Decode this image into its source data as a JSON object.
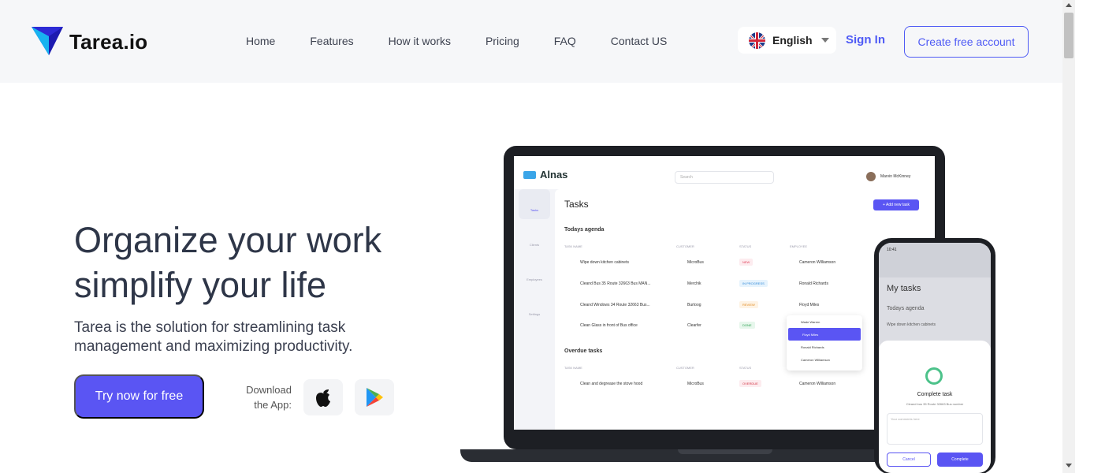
{
  "header": {
    "brand": "Tarea.io",
    "nav": [
      "Home",
      "Features",
      "How it works",
      "Pricing",
      "FAQ",
      "Contact US"
    ],
    "language": "English",
    "signin": "Sign In",
    "create": "Create free account"
  },
  "hero": {
    "title_line1": "Organize your work",
    "title_line2": "simplify your life",
    "subtitle": "Tarea is the solution for streamlining task management and maximizing productivity.",
    "cta": "Try now for free",
    "download_line1": "Download",
    "download_line2": "the App:"
  },
  "laptop_app": {
    "brand": "Alnas",
    "search_placeholder": "Search",
    "user": "Marvin McKinney",
    "title": "Tasks",
    "add_task": "+ Add new task",
    "sidebar": [
      "Tasks",
      "Clients",
      "Employees",
      "Settings"
    ],
    "agenda_title": "Todays agenda",
    "columns": [
      "TASK NAME",
      "CUSTOMER",
      "STATUS",
      "EMPLOYEE"
    ],
    "rows": [
      {
        "name": "Wipe down kitchen cabinets",
        "customer": "MicroBus",
        "status": "NEW",
        "employee": "Cameron Williamson"
      },
      {
        "name": "Cleand Bus 35 Route 32663 Bus MAN...",
        "customer": "Merchik",
        "status": "IN PROGRESS",
        "employee": "Ronald Richards"
      },
      {
        "name": "Cleand Windows 34 Route 32663 Bus...",
        "customer": "Burtoog",
        "status": "REVIEW",
        "employee": "Floyd Miles"
      },
      {
        "name": "Clean Glass in front of Bus office",
        "customer": "Clearfer",
        "status": "DONE",
        "employee": ""
      }
    ],
    "overdue_title": "Overdue tasks",
    "overdue_rows": [
      {
        "name": "Clean and degrease the stove hood",
        "customer": "MicroBus",
        "status": "OVERDUE",
        "employee": "Cameron Williamson"
      }
    ],
    "dropdown": [
      "Wade Warren",
      "Floyd Miles",
      "Ronald Richards",
      "Cameron Williamson"
    ]
  },
  "phone_app": {
    "time": "10:41",
    "title": "My tasks",
    "agenda": "Todays agenda",
    "item": "Wipe down kitchen cabinets",
    "sheet_title": "Complete task",
    "sheet_sub": "Cleand bus 35 Route 32663 Bus number",
    "comments_placeholder": "Your comments here",
    "cancel": "Cancel",
    "complete": "Complete"
  },
  "colors": {
    "accent": "#5a55f3",
    "link": "#4f5bf5",
    "header_bg": "#f6f7f9"
  }
}
